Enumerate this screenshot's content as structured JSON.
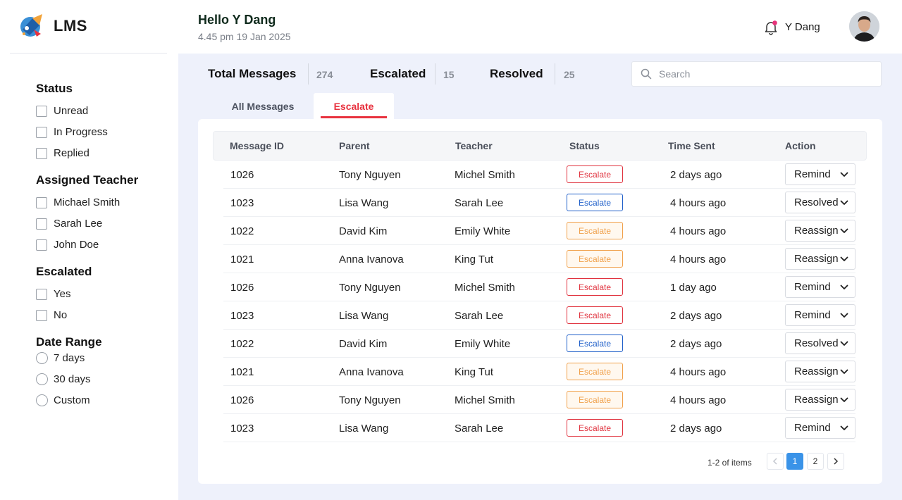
{
  "app": {
    "name": "LMS"
  },
  "header": {
    "greeting": "Hello Y Dang",
    "datetime": "4.45 pm 19 Jan 2025",
    "username": "Y Dang"
  },
  "filters": {
    "status": {
      "title": "Status",
      "options": [
        "Unread",
        "In Progress",
        "Replied"
      ]
    },
    "teacher": {
      "title": "Assigned Teacher",
      "options": [
        "Michael Smith",
        "Sarah Lee",
        "John Doe"
      ]
    },
    "escalated": {
      "title": "Escalated",
      "options": [
        "Yes",
        "No"
      ]
    },
    "date_range": {
      "title": "Date Range",
      "options": [
        "7 days",
        "30 days",
        "Custom"
      ]
    }
  },
  "stats": {
    "total_label": "Total Messages",
    "total_value": "274",
    "escalated_label": "Escalated",
    "escalated_value": "15",
    "resolved_label": "Resolved",
    "resolved_value": "25"
  },
  "search": {
    "placeholder": "Search"
  },
  "tabs": {
    "all": "All Messages",
    "escalate": "Escalate"
  },
  "table": {
    "headers": [
      "Message ID",
      "Parent",
      "Teacher",
      "Status",
      "Time Sent",
      "Action"
    ],
    "rows": [
      {
        "id": "1026",
        "parent": "Tony Nguyen",
        "teacher": "Michel Smith",
        "status": "Escalate",
        "status_color": "red",
        "time": "2 days ago",
        "action": "Remind"
      },
      {
        "id": "1023",
        "parent": "Lisa Wang",
        "teacher": "Sarah Lee",
        "status": "Escalate",
        "status_color": "blue",
        "time": "4 hours ago",
        "action": "Resolved"
      },
      {
        "id": "1022",
        "parent": "David Kim",
        "teacher": "Emily White",
        "status": "Escalate",
        "status_color": "orange",
        "time": "4 hours ago",
        "action": "Reassign"
      },
      {
        "id": "1021",
        "parent": "Anna Ivanova",
        "teacher": "King Tut",
        "status": "Escalate",
        "status_color": "orange",
        "time": "4 hours ago",
        "action": "Reassign"
      },
      {
        "id": "1026",
        "parent": "Tony Nguyen",
        "teacher": "Michel Smith",
        "status": "Escalate",
        "status_color": "red",
        "time": "1 day ago",
        "action": "Remind"
      },
      {
        "id": "1023",
        "parent": "Lisa Wang",
        "teacher": "Sarah Lee",
        "status": "Escalate",
        "status_color": "red",
        "time": "2 days ago",
        "action": "Remind"
      },
      {
        "id": "1022",
        "parent": "David Kim",
        "teacher": "Emily White",
        "status": "Escalate",
        "status_color": "blue",
        "time": "2 days ago",
        "action": "Resolved"
      },
      {
        "id": "1021",
        "parent": "Anna Ivanova",
        "teacher": "King Tut",
        "status": "Escalate",
        "status_color": "orange",
        "time": "4 hours ago",
        "action": "Reassign"
      },
      {
        "id": "1026",
        "parent": "Tony Nguyen",
        "teacher": "Michel Smith",
        "status": "Escalate",
        "status_color": "orange",
        "time": "4 hours ago",
        "action": "Reassign"
      },
      {
        "id": "1023",
        "parent": "Lisa Wang",
        "teacher": "Sarah Lee",
        "status": "Escalate",
        "status_color": "red",
        "time": "2 days ago",
        "action": "Remind"
      }
    ]
  },
  "pagination": {
    "summary": "1-2 of items",
    "pages": [
      "1",
      "2"
    ],
    "current": "1"
  },
  "colors": {
    "accent": "#e8323f",
    "primary": "#3a93e8",
    "escalate_red": "#e0323e",
    "escalate_blue": "#1f5fc9",
    "escalate_orange": "#f0a04a"
  }
}
